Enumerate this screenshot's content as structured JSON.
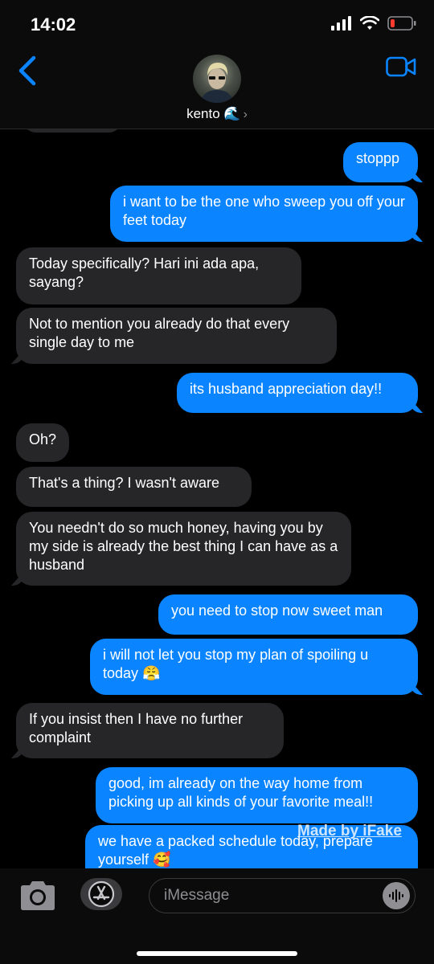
{
  "status": {
    "time": "14:02"
  },
  "header": {
    "contact_name": "kento 🌊",
    "chevron": "›"
  },
  "messages": [
    {
      "from": "me",
      "text": "stoppp"
    },
    {
      "from": "me",
      "text": "i want to be the one who sweep you off your feet today"
    },
    {
      "from": "them",
      "text": "Today specifically? Hari ini ada apa, sayang?"
    },
    {
      "from": "them",
      "text": "Not to mention you already do that every single day to me"
    },
    {
      "from": "me",
      "text": "its husband appreciation day!!"
    },
    {
      "from": "them",
      "text": "Oh?"
    },
    {
      "from": "them",
      "text": "That's a thing? I wasn't aware"
    },
    {
      "from": "them",
      "text": "You needn't do so much honey, having you by my side is already the best thing I can have as a husband"
    },
    {
      "from": "me",
      "text": "you need to stop now sweet man"
    },
    {
      "from": "me",
      "text": "i will not let you stop my plan of spoiling u today 😤"
    },
    {
      "from": "them",
      "text": "If you insist then I have no further complaint"
    },
    {
      "from": "me",
      "text": "good, im already on the way home from picking up all kinds of your favorite meal!!"
    },
    {
      "from": "me",
      "text": "we have a packed schedule today, prepare yourself 🥰"
    }
  ],
  "watermark": "Made by iFake",
  "input": {
    "placeholder": "iMessage"
  },
  "colors": {
    "outgoing": "#0a84ff",
    "incoming": "#262628",
    "accent": "#0a84ff"
  }
}
